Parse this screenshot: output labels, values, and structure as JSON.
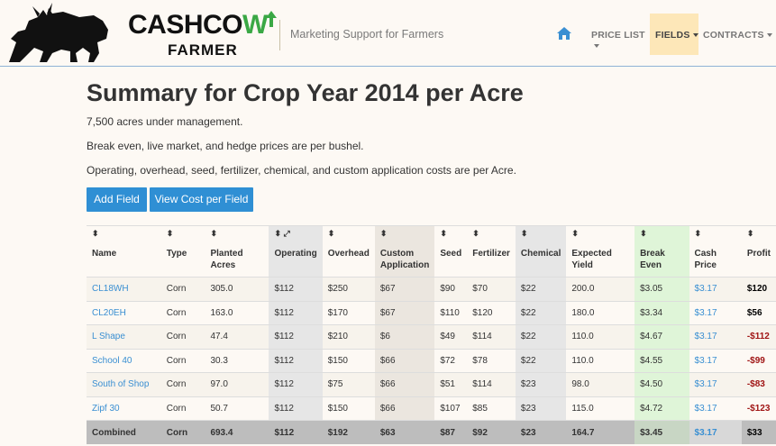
{
  "brand": {
    "name_prefix": "CASHCO",
    "name_w": "W",
    "sub": "FARMER",
    "tagline": "Marketing Support for Farmers"
  },
  "nav": {
    "home_icon": "home-icon",
    "items": [
      {
        "label": "PRICE LIST"
      },
      {
        "label": "FIELDS"
      },
      {
        "label": "CONTRACTS"
      }
    ]
  },
  "page": {
    "title": "Summary for Crop Year 2014 per Acre",
    "line1": "7,500 acres under management.",
    "line2": "Break even, live market, and hedge prices are per bushel.",
    "line3": "Operating, overhead, seed, fertilizer, chemical, and custom application costs are per Acre."
  },
  "buttons": {
    "add_field": "Add Field",
    "view_cost": "View Cost per Field"
  },
  "table": {
    "headers": {
      "name": "Name",
      "type": "Type",
      "planted": "Planted Acres",
      "operating": "Operating",
      "overhead": "Overhead",
      "custom1": "Custom",
      "custom2": "Application",
      "seed": "Seed",
      "fertilizer": "Fertilizer",
      "chemical": "Chemical",
      "yield": "Expected Yield",
      "break_even": "Break Even",
      "cash": "Cash Price",
      "profit": "Profit"
    },
    "rows": [
      {
        "name": "CL18WH",
        "type": "Corn",
        "acres": "305.0",
        "oper": "$112",
        "over": "$250",
        "custom": "$67",
        "seed": "$90",
        "fert": "$70",
        "chem": "$22",
        "yield": "200.0",
        "be": "$3.05",
        "cash": "$3.17",
        "profit": "$120"
      },
      {
        "name": "CL20EH",
        "type": "Corn",
        "acres": "163.0",
        "oper": "$112",
        "over": "$170",
        "custom": "$67",
        "seed": "$110",
        "fert": "$120",
        "chem": "$22",
        "yield": "180.0",
        "be": "$3.34",
        "cash": "$3.17",
        "profit": "$56"
      },
      {
        "name": "L Shape",
        "type": "Corn",
        "acres": "47.4",
        "oper": "$112",
        "over": "$210",
        "custom": "$6",
        "seed": "$49",
        "fert": "$114",
        "chem": "$22",
        "yield": "110.0",
        "be": "$4.67",
        "cash": "$3.17",
        "profit": "-$112"
      },
      {
        "name": "School 40",
        "type": "Corn",
        "acres": "30.3",
        "oper": "$112",
        "over": "$150",
        "custom": "$66",
        "seed": "$72",
        "fert": "$78",
        "chem": "$22",
        "yield": "110.0",
        "be": "$4.55",
        "cash": "$3.17",
        "profit": "-$99"
      },
      {
        "name": "South of Shop",
        "type": "Corn",
        "acres": "97.0",
        "oper": "$112",
        "over": "$75",
        "custom": "$66",
        "seed": "$51",
        "fert": "$114",
        "chem": "$23",
        "yield": "98.0",
        "be": "$4.50",
        "cash": "$3.17",
        "profit": "-$83"
      },
      {
        "name": "Zipf 30",
        "type": "Corn",
        "acres": "50.7",
        "oper": "$112",
        "over": "$150",
        "custom": "$66",
        "seed": "$107",
        "fert": "$85",
        "chem": "$23",
        "yield": "115.0",
        "be": "$4.72",
        "cash": "$3.17",
        "profit": "-$123"
      }
    ],
    "combined": {
      "name": "Combined",
      "type": "Corn",
      "acres": "693.4",
      "oper": "$112",
      "over": "$192",
      "custom": "$63",
      "seed": "$87",
      "fert": "$92",
      "chem": "$23",
      "yield": "164.7",
      "be": "$3.45",
      "cash": "$3.17",
      "profit": "$33"
    }
  },
  "colors": {
    "accent": "#2f8fd4",
    "active_nav": "#fde7b8",
    "break_even_bg": "#dff5d8",
    "negative": "#a01515",
    "brand_green": "#3aa845"
  }
}
